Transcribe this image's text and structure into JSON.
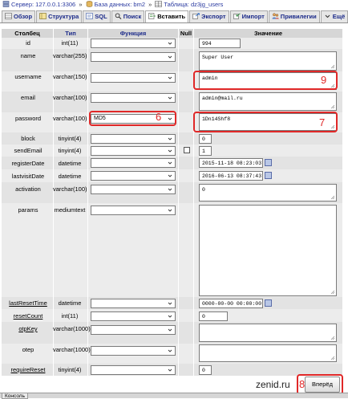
{
  "breadcrumb": {
    "server_label": "Сервер: 127.0.0.1:3306",
    "db_label": "База данных: bm2",
    "table_label": "Таблица: dz3jg_users",
    "separator": "»"
  },
  "tabs": [
    {
      "label": "Обзор",
      "icon": "browse-icon"
    },
    {
      "label": "Структура",
      "icon": "structure-icon"
    },
    {
      "label": "SQL",
      "icon": "sql-icon"
    },
    {
      "label": "Поиск",
      "icon": "search-icon"
    },
    {
      "label": "Вставить",
      "icon": "insert-icon",
      "active": true
    },
    {
      "label": "Экспорт",
      "icon": "export-icon"
    },
    {
      "label": "Импорт",
      "icon": "import-icon"
    },
    {
      "label": "Привилегии",
      "icon": "privileges-icon"
    },
    {
      "label": "Ещё",
      "icon": "more-chevron-icon"
    }
  ],
  "headers": {
    "column": "Столбец",
    "type": "Тип",
    "function": "Функция",
    "null": "Null",
    "value": "Значение"
  },
  "rows": {
    "id": {
      "name": "id",
      "type": "int(11)",
      "func": "",
      "value": "994"
    },
    "name": {
      "name": "name",
      "type": "varchar(255)",
      "func": "",
      "value": "Super User"
    },
    "username": {
      "name": "username",
      "type": "varchar(150)",
      "func": "",
      "value": "admin"
    },
    "email": {
      "name": "email",
      "type": "varchar(100)",
      "func": "",
      "value": "admin@mail.ru"
    },
    "password": {
      "name": "password",
      "type": "varchar(100)",
      "func": "MD5",
      "value": "1Dn14Shf8"
    },
    "block": {
      "name": "block",
      "type": "tinyint(4)",
      "func": "",
      "value": "0"
    },
    "sendEmail": {
      "name": "sendEmail",
      "type": "tinyint(4)",
      "func": "",
      "value": "1"
    },
    "registerDate": {
      "name": "registerDate",
      "type": "datetime",
      "func": "",
      "value": "2015-11-18 08:23:03"
    },
    "lastvisitDate": {
      "name": "lastvisitDate",
      "type": "datetime",
      "func": "",
      "value": "2016-06-13 08:37:43"
    },
    "activation": {
      "name": "activation",
      "type": "varchar(100)",
      "func": "",
      "value": "0"
    },
    "params": {
      "name": "params",
      "type": "mediumtext",
      "func": "",
      "value": ""
    },
    "lastResetTime": {
      "name": "lastResetTime",
      "type": "datetime",
      "func": "",
      "value": "0000-00-00 00:00:00"
    },
    "resetCount": {
      "name": "resetCount",
      "type": "int(11)",
      "func": "",
      "value": "0"
    },
    "otpKey": {
      "name": "otpKey",
      "type": "varchar(1000)",
      "func": "",
      "value": ""
    },
    "otep": {
      "name": "otep",
      "type": "varchar(1000)",
      "func": "",
      "value": ""
    },
    "requireReset": {
      "name": "requireReset",
      "type": "tinyint(4)",
      "func": "",
      "value": "0"
    }
  },
  "annotations": {
    "username_mark": "9",
    "password_mark": "7",
    "function_mark": "6",
    "button_mark": "8"
  },
  "watermark": "zenid.ru",
  "go_button": "Вперёд",
  "console_label": "Консоль",
  "colors": {
    "accent": "#1c2b8a",
    "highlight": "#e02828",
    "row_even": "#e3e3e3",
    "row_odd": "#ececec",
    "header_bg": "#d6d6d6"
  }
}
